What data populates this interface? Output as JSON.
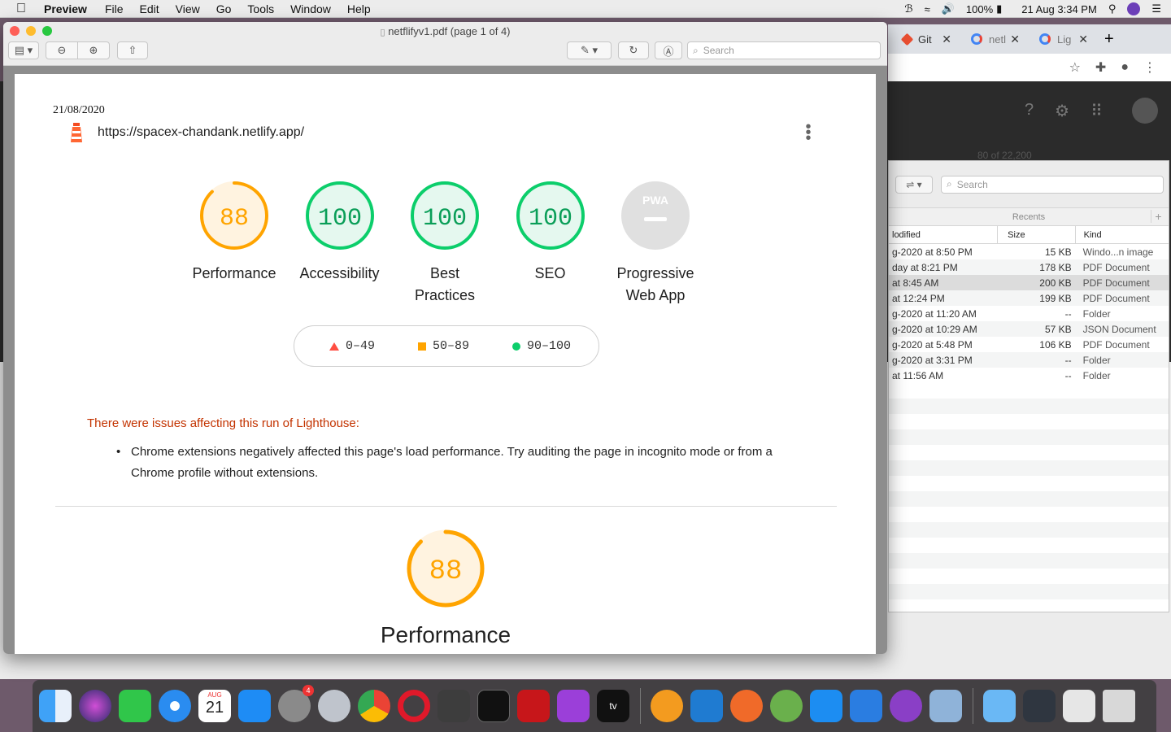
{
  "menubar": {
    "app": "Preview",
    "items": [
      "File",
      "Edit",
      "View",
      "Go",
      "Tools",
      "Window",
      "Help"
    ],
    "battery": "100%",
    "datetime": "21 Aug  3:34 PM"
  },
  "preview": {
    "title": "netflifyv1.pdf (page 1 of 4)",
    "search_placeholder": "Search"
  },
  "report": {
    "date": "21/08/2020",
    "url": "https://spacex-chandank.netlify.app/",
    "gauges": [
      {
        "score": "88",
        "label": "Performance",
        "color": "#ffa400",
        "fraction": 0.88
      },
      {
        "score": "100",
        "label": "Accessibility",
        "color": "#0cce6b",
        "fraction": 1.0
      },
      {
        "score": "100",
        "label": "Best Practices",
        "color": "#0cce6b",
        "fraction": 1.0
      },
      {
        "score": "100",
        "label": "SEO",
        "color": "#0cce6b",
        "fraction": 1.0
      },
      {
        "score": "",
        "label": "Progressive Web App",
        "color": "#e0e0e0",
        "fraction": 0
      }
    ],
    "pwa_text": "PWA",
    "legend": [
      "0–49",
      "50–89",
      "90–100"
    ],
    "warning_title": "There were issues affecting this run of Lighthouse:",
    "warning_item": "Chrome extensions negatively affected this page's load performance. Try auditing the page in incognito mode or from a Chrome profile without extensions.",
    "section_score": "88",
    "section_title": "Performance"
  },
  "chrome": {
    "tabs": [
      "Git",
      "netl",
      "Lig"
    ],
    "pager": "80 of 22,200"
  },
  "finder": {
    "search_placeholder": "Search",
    "section": "Recents",
    "columns": [
      "lodified",
      "Size",
      "Kind"
    ],
    "rows": [
      {
        "modified": "g-2020 at 8:50 PM",
        "size": "15 KB",
        "kind": "Windo...n image"
      },
      {
        "modified": "day at 8:21 PM",
        "size": "178 KB",
        "kind": "PDF Document"
      },
      {
        "modified": "at 8:45 AM",
        "size": "200 KB",
        "kind": "PDF Document"
      },
      {
        "modified": "at 12:24 PM",
        "size": "199 KB",
        "kind": "PDF Document"
      },
      {
        "modified": "g-2020 at 11:20 AM",
        "size": "--",
        "kind": "Folder"
      },
      {
        "modified": "g-2020 at 10:29 AM",
        "size": "57 KB",
        "kind": "JSON Document"
      },
      {
        "modified": "g-2020 at 5:48 PM",
        "size": "106 KB",
        "kind": "PDF Document"
      },
      {
        "modified": "g-2020 at 3:31 PM",
        "size": "--",
        "kind": "Folder"
      },
      {
        "modified": "at 11:56 AM",
        "size": "--",
        "kind": "Folder"
      }
    ]
  },
  "dock": {
    "calendar_month": "AUG",
    "calendar_day": "21",
    "prefs_badge": "4",
    "tv_label": "tv"
  }
}
